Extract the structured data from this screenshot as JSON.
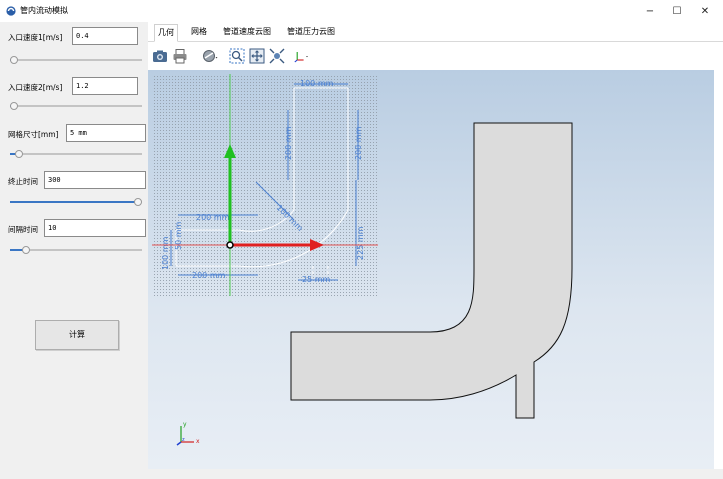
{
  "window": {
    "title": "管内流动模拟",
    "controls": [
      "−",
      "☐",
      "✕"
    ]
  },
  "params": [
    {
      "label": "入口速度1[m/s]",
      "value": "0.4",
      "slider_level": 0.0
    },
    {
      "label": "入口速度2[m/s]",
      "value": "1.2",
      "slider_level": 0.0
    },
    {
      "label": "网格尺寸[mm]",
      "value": "5 mm",
      "slider_level": 0.04
    },
    {
      "label": "终止时间",
      "value": "300",
      "slider_level": 1.0
    },
    {
      "label": "间隔时间",
      "value": "10",
      "slider_level": 0.1
    }
  ],
  "calc_button": "计算",
  "tabs": [
    {
      "label": "几何",
      "active": true
    },
    {
      "label": "网格",
      "active": false
    },
    {
      "label": "管道速度云图",
      "active": false
    },
    {
      "label": "管道压力云图",
      "active": false
    }
  ],
  "toolbar_icons": [
    "camera-icon",
    "printer-icon",
    "render-mode-icon",
    "zoom-box-icon",
    "zoom-fit-icon",
    "view-orientation-icon",
    "axes-icon"
  ],
  "sketch": {
    "dimensions": [
      "100 mm",
      "200 mm",
      "200 mm",
      "100 mm",
      "200 mm",
      "50 mm",
      "100 mm",
      "200 mm",
      "225 mm",
      "25 mm"
    ]
  },
  "triad": {
    "x": "x",
    "y": "y",
    "z": "z"
  },
  "colors": {
    "x_axis": "#e02020",
    "y_axis": "#20c020",
    "slider_fill": "#3a76c4",
    "dimension": "#4a7fd0",
    "pipe_fill": "#dcdcdc"
  }
}
